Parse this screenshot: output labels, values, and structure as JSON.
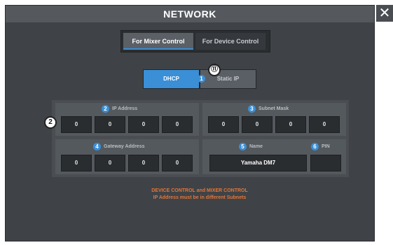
{
  "window": {
    "title": "NETWORK",
    "close_glyph": "✕"
  },
  "tabs": [
    {
      "label": "For Mixer Control",
      "active": true
    },
    {
      "label": "For Device Control",
      "active": false
    }
  ],
  "mode": {
    "dhcp_label": "DHCP",
    "static_label": "Static IP",
    "selected": "DHCP",
    "badge_number": "1",
    "callout": "⑪"
  },
  "ip_address": {
    "badge": "2",
    "label": "IP Address",
    "callout": "2",
    "octets": [
      "0",
      "0",
      "0",
      "0"
    ]
  },
  "subnet_mask": {
    "badge": "3",
    "label": "Subnet Mask",
    "octets": [
      "0",
      "0",
      "0",
      "0"
    ]
  },
  "gateway": {
    "badge": "4",
    "label": "Gateway Address",
    "octets": [
      "0",
      "0",
      "0",
      "0"
    ]
  },
  "device_name": {
    "badge": "5",
    "label": "Name",
    "value": "Yamaha DM7"
  },
  "pin": {
    "badge": "6",
    "label": "PIN",
    "value": ""
  },
  "warning": {
    "line1": "DEVICE CONTROL and MIXER CONTROL",
    "line2": "IP Address must be in different Subnets"
  },
  "colors": {
    "accent": "#3a8fd6",
    "warning": "#e2763a",
    "background": "#3f4347"
  }
}
